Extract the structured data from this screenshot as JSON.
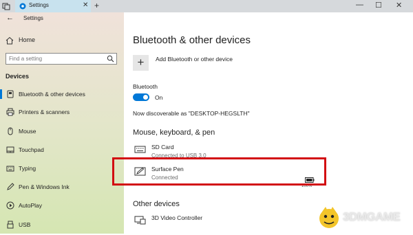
{
  "window": {
    "tab_title": "Settings",
    "tab_close": "✕",
    "new_tab": "+",
    "minimize": "—",
    "maximize": "☐",
    "close": "✕"
  },
  "sidebar": {
    "back": "←",
    "title": "Settings",
    "home_label": "Home",
    "search_placeholder": "Find a setting",
    "section_header": "Devices",
    "items": [
      {
        "label": "Bluetooth & other devices",
        "icon": "bluetooth-icon",
        "active": true
      },
      {
        "label": "Printers & scanners",
        "icon": "printer-icon"
      },
      {
        "label": "Mouse",
        "icon": "mouse-icon"
      },
      {
        "label": "Touchpad",
        "icon": "touchpad-icon"
      },
      {
        "label": "Typing",
        "icon": "keyboard-icon"
      },
      {
        "label": "Pen & Windows Ink",
        "icon": "pen-icon"
      },
      {
        "label": "AutoPlay",
        "icon": "autoplay-icon"
      },
      {
        "label": "USB",
        "icon": "usb-icon"
      }
    ]
  },
  "main": {
    "title": "Bluetooth & other devices",
    "add_plus": "+",
    "add_label": "Add Bluetooth or other device",
    "bluetooth_label": "Bluetooth",
    "toggle_state": "On",
    "discoverable": "Now discoverable as \"DESKTOP-HEGSLTH\"",
    "mkp_header": "Mouse, keyboard, & pen",
    "mkp_devices": [
      {
        "name": "SD Card",
        "status": "Connected to USB 3.0",
        "icon": "keyboard-icon"
      },
      {
        "name": "Surface Pen",
        "status": "Connected",
        "icon": "pen-icon",
        "battery": "100%"
      }
    ],
    "other_header": "Other devices",
    "other_devices": [
      {
        "name": "3D Video Controller",
        "icon": "display-icon"
      }
    ]
  },
  "watermark": {
    "text": "3DMGAME"
  },
  "colors": {
    "accent": "#0078d7",
    "highlight": "#d20a11"
  }
}
